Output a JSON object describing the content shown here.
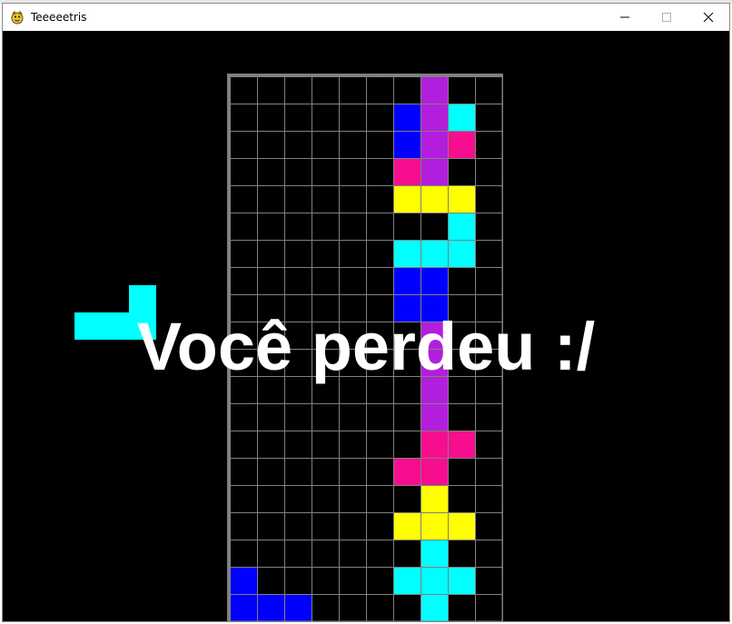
{
  "window": {
    "title": "Teeeeetris",
    "app_icon": "pygame-snake-icon",
    "controls": [
      {
        "name": "minimize-button",
        "icon": "minimize-icon"
      },
      {
        "name": "maximize-button",
        "icon": "maximize-icon"
      },
      {
        "name": "close-button",
        "icon": "close-icon"
      }
    ]
  },
  "colors": {
    "blue": "#0000ff",
    "purple": "#b21edb",
    "cyan": "#00ffff",
    "magenta": "#f70e8e",
    "yellow": "#ffff00",
    "grid_line": "#808080",
    "border": "#808080",
    "background": "#000000"
  },
  "board": {
    "columns": 10,
    "rows": 20,
    "cells": [
      ".......P..",
      "......BPC.",
      "......BPM.",
      "......MP..",
      "......YYY.",
      "........C.",
      "......CCC.",
      "......BB..",
      "......BB..",
      ".......P..",
      ".......P..",
      ".......P..",
      ".......P..",
      ".......MM.",
      "......MM..",
      ".......Y..",
      "......YYY.",
      ".......C..",
      "B.....CCC.",
      "BBB....C.."
    ]
  },
  "next_piece": {
    "color": "cyan",
    "shape": [
      "..C",
      "CCC"
    ]
  },
  "message": "Você perdeu :/"
}
